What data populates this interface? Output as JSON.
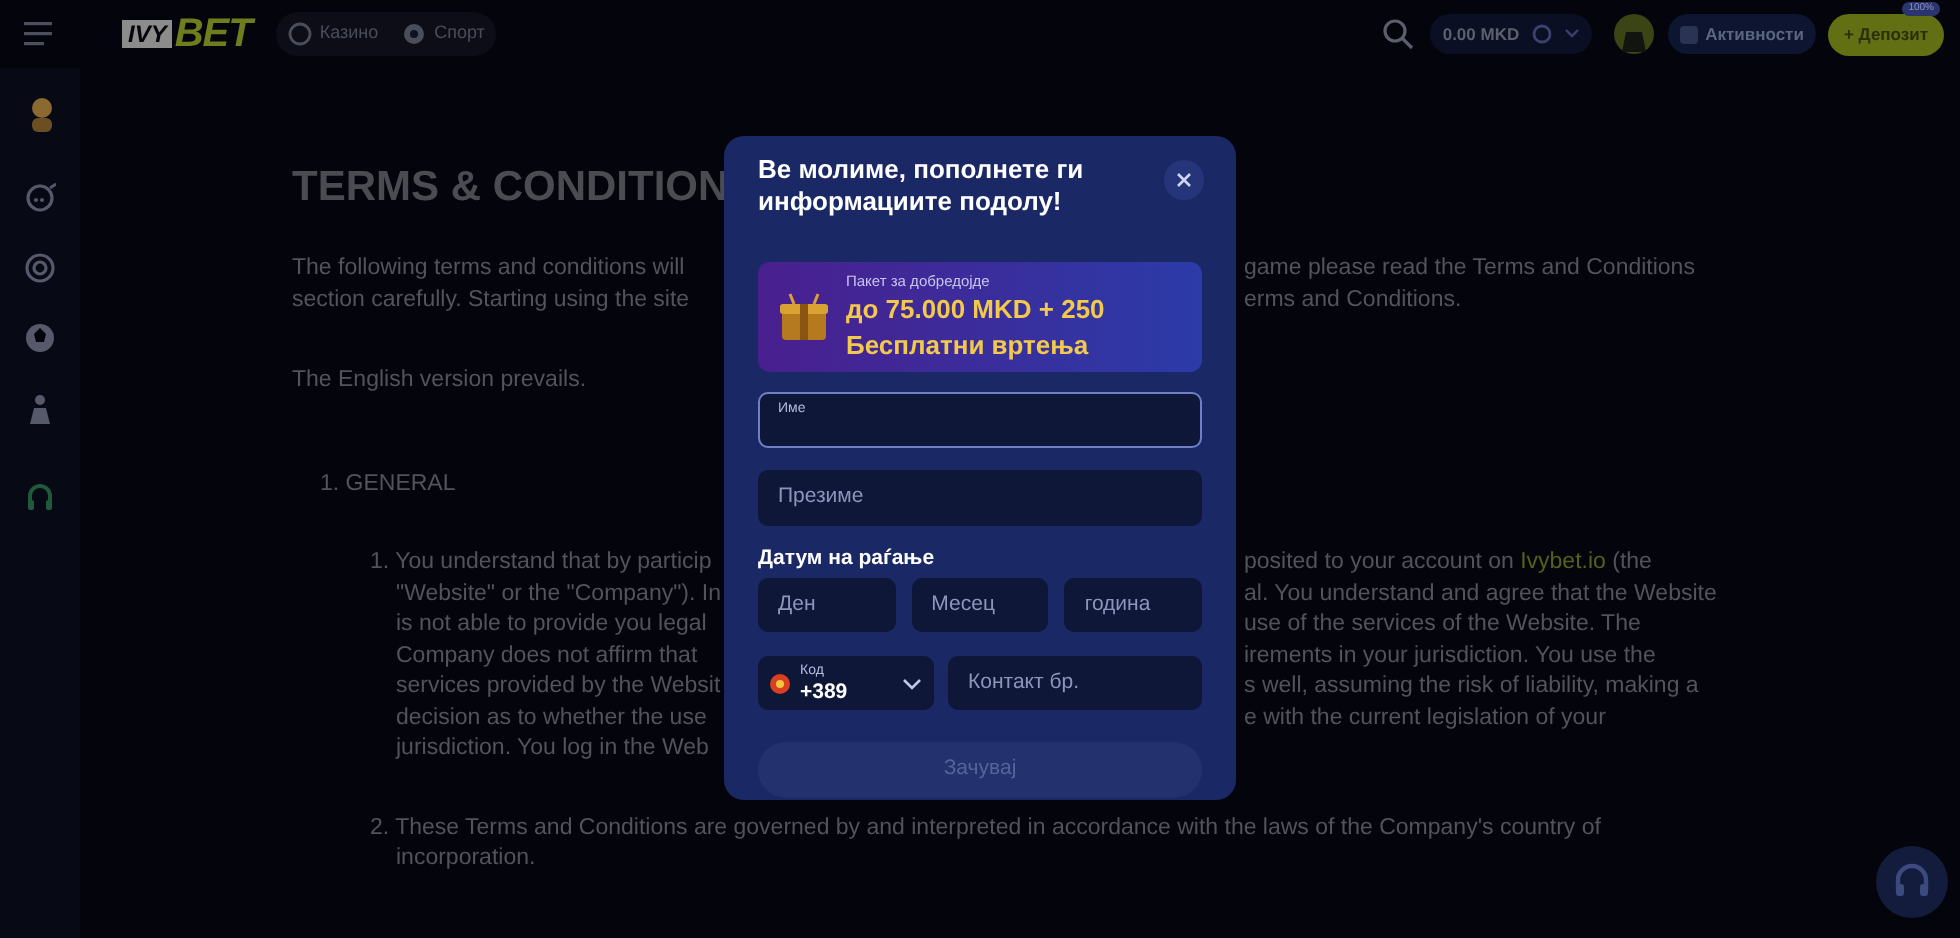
{
  "header": {
    "logo": {
      "left": "IVY",
      "right": "BET"
    },
    "nav": [
      {
        "label": "Казино"
      },
      {
        "label": "Спорт"
      }
    ],
    "balance": "0.00 MKD",
    "activities": "Активности",
    "deposit": {
      "plus": "+",
      "label": "Депозит",
      "badge": "100%"
    }
  },
  "content": {
    "title": "TERMS & CONDITION",
    "blocks": [
      {
        "kind": "para",
        "lines": [
          {
            "left": "The following terms and conditions will",
            "right": [
              {
                "kind": "text",
                "text": "game please read the Terms and Conditions"
              }
            ]
          },
          {
            "left": "section carefully. Starting using the site",
            "right": [
              {
                "kind": "text",
                "text": "erms and Conditions."
              }
            ]
          }
        ]
      },
      {
        "kind": "para",
        "lines": [
          {
            "left": "The English version prevails."
          }
        ]
      },
      {
        "kind": "section",
        "lines": [
          {
            "left": "1. GENERAL"
          }
        ]
      },
      {
        "kind": "item",
        "lines": [
          {
            "left": "1. You understand that by particip",
            "right": [
              {
                "kind": "text",
                "text": "posited to your account on "
              },
              {
                "kind": "link",
                "text": "Ivybet.io"
              },
              {
                "kind": "text",
                "text": " (the"
              }
            ]
          },
          {
            "left": "\"Website\" or the \"Company\"). In",
            "right": [
              {
                "kind": "text",
                "text": "al. You understand and agree that the Website"
              }
            ]
          },
          {
            "left": "is not able to provide you legal",
            "right": [
              {
                "kind": "text",
                "text": "use of the services of the Website. The"
              }
            ]
          },
          {
            "left": "Company does not affirm that",
            "right": [
              {
                "kind": "text",
                "text": "irements in your jurisdiction. You use the"
              }
            ]
          },
          {
            "left": "services provided by the Websit",
            "right": [
              {
                "kind": "text",
                "text": "s well, assuming the risk of liability, making a"
              }
            ]
          },
          {
            "left": "decision as to whether the use",
            "right": [
              {
                "kind": "text",
                "text": "e with the current legislation of your"
              }
            ]
          },
          {
            "left": "jurisdiction. You log in the Web"
          }
        ]
      },
      {
        "kind": "item",
        "lines": [
          {
            "left": "2. These Terms and Conditions are governed by and interpreted in accordance with the laws of the Company's country of"
          },
          {
            "left": "incorporation."
          }
        ]
      }
    ]
  },
  "modal": {
    "title": "Ве молиме, пополнете ги информациите подолу!",
    "promo": {
      "caption": "Пакет за добредојде",
      "line1": "до 75.000 MKD + 250",
      "line2": "Бесплатни вртења"
    },
    "fields": [
      {
        "kind": "floating",
        "label": "Име",
        "focused": true
      },
      {
        "kind": "plain",
        "placeholder": "Презиме",
        "focused": false
      }
    ],
    "birth": {
      "label": "Датум на раѓање",
      "fields": [
        {
          "placeholder": "Ден",
          "focused": false
        },
        {
          "placeholder": "Месец",
          "focused": false
        },
        {
          "placeholder": "година",
          "focused": false
        }
      ]
    },
    "phone": {
      "code_label": "Код",
      "code": "+389",
      "placeholder": "Контакт бр.",
      "focused": false
    },
    "submit": {
      "label": "Зачувај",
      "disabled": true
    }
  }
}
